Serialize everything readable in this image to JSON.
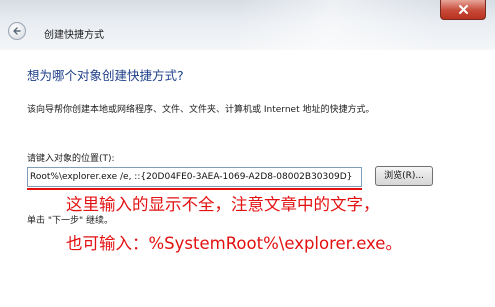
{
  "window": {
    "title": "创建快捷方式"
  },
  "wizard": {
    "heading": "想为哪个对象创建快捷方式?",
    "description": "该向导帮你创建本地或网络程序、文件、文件夹、计算机或 Internet 地址的快捷方式。",
    "location_label": "请键入对象的位置(T):",
    "location_value": "Root%\\explorer.exe  /e, ::{20D04FE0-3AEA-1069-A2D8-08002B30309D}",
    "browse_label": "浏览(R)...",
    "next_hint": "单击 \"下一步\" 继续。"
  },
  "annotation": {
    "line1": "这里输入的显示不全，注意文章中的文字，",
    "line2": "也可输入：%SystemRoot%\\explorer.exe。",
    "color": "#e31010"
  },
  "icons": {
    "back": "back-arrow-icon",
    "close": "close-icon"
  }
}
